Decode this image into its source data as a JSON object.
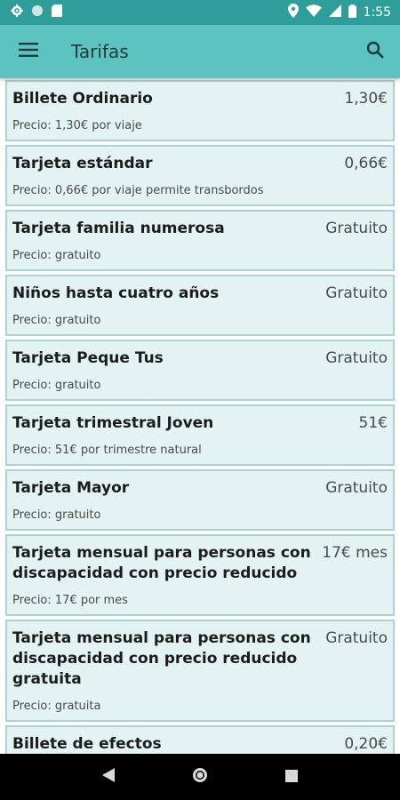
{
  "status_bar": {
    "time": "1:55",
    "icons": [
      "gear-icon",
      "circle-icon",
      "sd-card-icon",
      "location-icon",
      "wifi-icon",
      "signal-icon",
      "battery-icon"
    ]
  },
  "app_bar": {
    "title": "Tarifas",
    "icons": [
      "menu-icon",
      "search-icon"
    ]
  },
  "colors": {
    "status_bar": "#2f9e9a",
    "app_bar": "#5cc3c0",
    "card_bg": "#e3f3f3",
    "card_border": "#a9d4d2"
  },
  "fares": [
    {
      "title": "Billete Ordinario",
      "price": "1,30€",
      "detail": "Precio: 1,30€ por viaje"
    },
    {
      "title": "Tarjeta estándar",
      "price": "0,66€",
      "detail": "Precio: 0,66€ por viaje permite transbordos"
    },
    {
      "title": "Tarjeta familia numerosa",
      "price": "Gratuito",
      "detail": "Precio: gratuito"
    },
    {
      "title": "Niños hasta cuatro años",
      "price": "Gratuito",
      "detail": "Precio: gratuito"
    },
    {
      "title": "Tarjeta Peque Tus",
      "price": "Gratuito",
      "detail": "Precio: gratuito"
    },
    {
      "title": "Tarjeta trimestral Joven",
      "price": "51€",
      "detail": "Precio: 51€ por trimestre natural"
    },
    {
      "title": "Tarjeta Mayor",
      "price": "Gratuito",
      "detail": "Precio: gratuito"
    },
    {
      "title": "Tarjeta mensual para personas con discapacidad con precio reducido",
      "price": "17€ mes",
      "detail": "Precio: 17€ por mes"
    },
    {
      "title": "Tarjeta mensual para personas con discapacidad con precio reducido gratuita",
      "price": "Gratuito",
      "detail": "Precio: gratuita"
    },
    {
      "title": "Billete de efectos",
      "price": "0,20€",
      "detail": ""
    }
  ],
  "nav_bar": {
    "icons": [
      "back-icon",
      "home-icon",
      "recents-icon"
    ]
  }
}
